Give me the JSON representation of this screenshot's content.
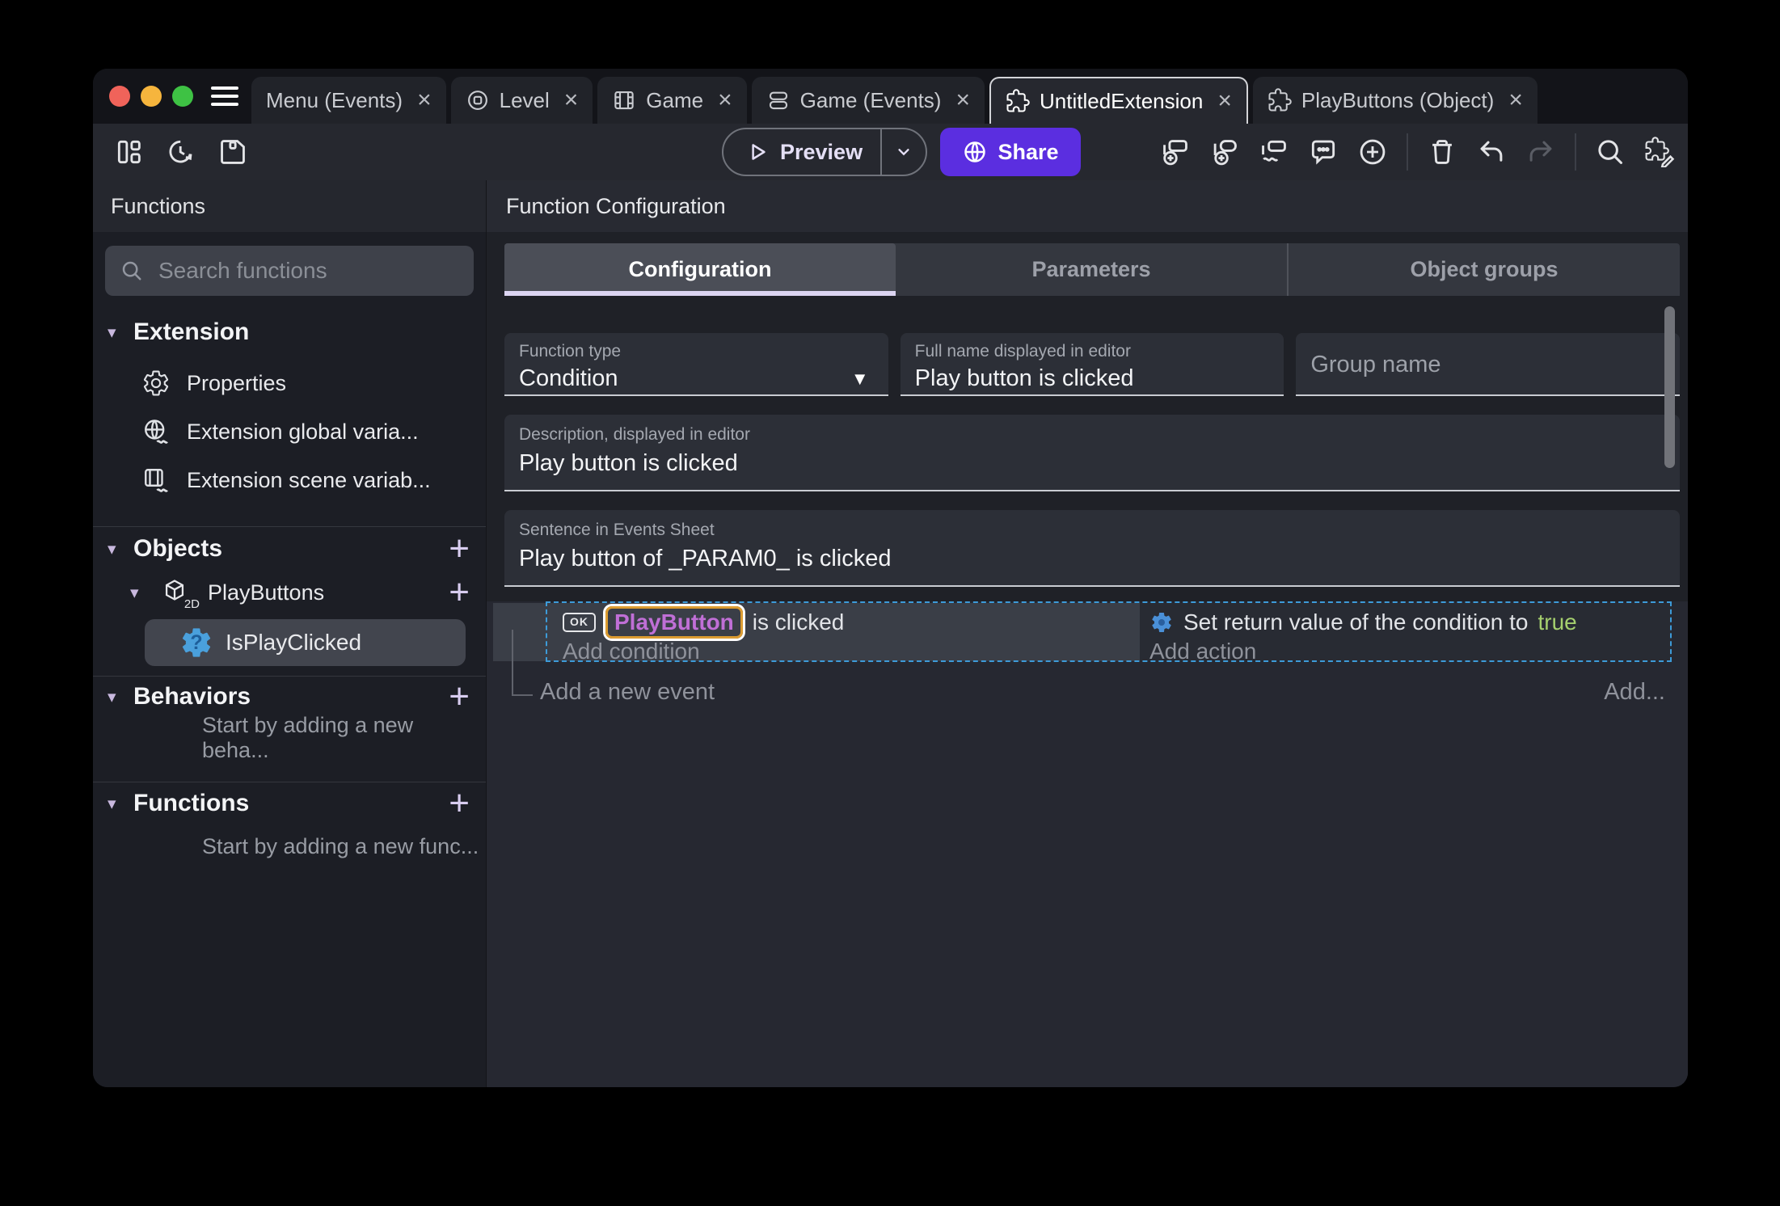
{
  "tabs": {
    "close_glyph": "×",
    "items": [
      {
        "label": "Menu (Events)"
      },
      {
        "label": "Level"
      },
      {
        "label": "Game"
      },
      {
        "label": "Game (Events)"
      },
      {
        "label": "UntitledExtension"
      },
      {
        "label": "PlayButtons (Object)"
      }
    ]
  },
  "toolbar": {
    "preview_label": "Preview",
    "share_label": "Share"
  },
  "sidebar": {
    "title": "Functions",
    "search_placeholder": "Search functions",
    "extension_header": "Extension",
    "items": {
      "properties": "Properties",
      "global_variables": "Extension global varia...",
      "scene_variables": "Extension scene variab..."
    },
    "objects_header": "Objects",
    "object_name": "PlayButtons",
    "object_badge": "2D",
    "function_name": "IsPlayClicked",
    "behaviors_header": "Behaviors",
    "behaviors_empty": "Start by adding a new beha...",
    "functions_header": "Functions",
    "functions_empty": "Start by adding a new func..."
  },
  "main": {
    "header": "Function Configuration",
    "tabs": [
      {
        "label": "Configuration"
      },
      {
        "label": "Parameters"
      },
      {
        "label": "Object groups"
      }
    ],
    "function_type": {
      "label": "Function type",
      "value": "Condition"
    },
    "full_name": {
      "label": "Full name displayed in editor",
      "value": "Play button is clicked"
    },
    "group_name": {
      "placeholder": "Group name"
    },
    "description": {
      "label": "Description, displayed in editor",
      "value": "Play button is clicked"
    },
    "sentence": {
      "label": "Sentence in Events Sheet",
      "value": "Play button of _PARAM0_ is clicked"
    }
  },
  "events": {
    "object_icon_label": "OK",
    "condition_object": "PlayButton",
    "condition_text": "is clicked",
    "add_condition": "Add condition",
    "action_text": "Set return value of the condition to",
    "action_value": "true",
    "add_action": "Add action",
    "add_new_event": "Add a new event",
    "add_button": "Add..."
  },
  "icons": {
    "caret_down_glyph": "▾",
    "plus_glyph": "+",
    "dropdown_glyph": "▼",
    "question_glyph": "?"
  },
  "colors": {
    "accent_purple": "#5b2ee0",
    "tab_underline": "#dcd5f2",
    "selection_dashed": "#3d9bd9",
    "object_name_text": "#c06fd6",
    "object_name_outline": "#dc9c31",
    "boolean_true": "#a5cf6e",
    "function_icon_blue": "#4aa0dc",
    "traffic_red": "#f0635a",
    "traffic_yellow": "#f6b53d",
    "traffic_green": "#3ec244"
  }
}
